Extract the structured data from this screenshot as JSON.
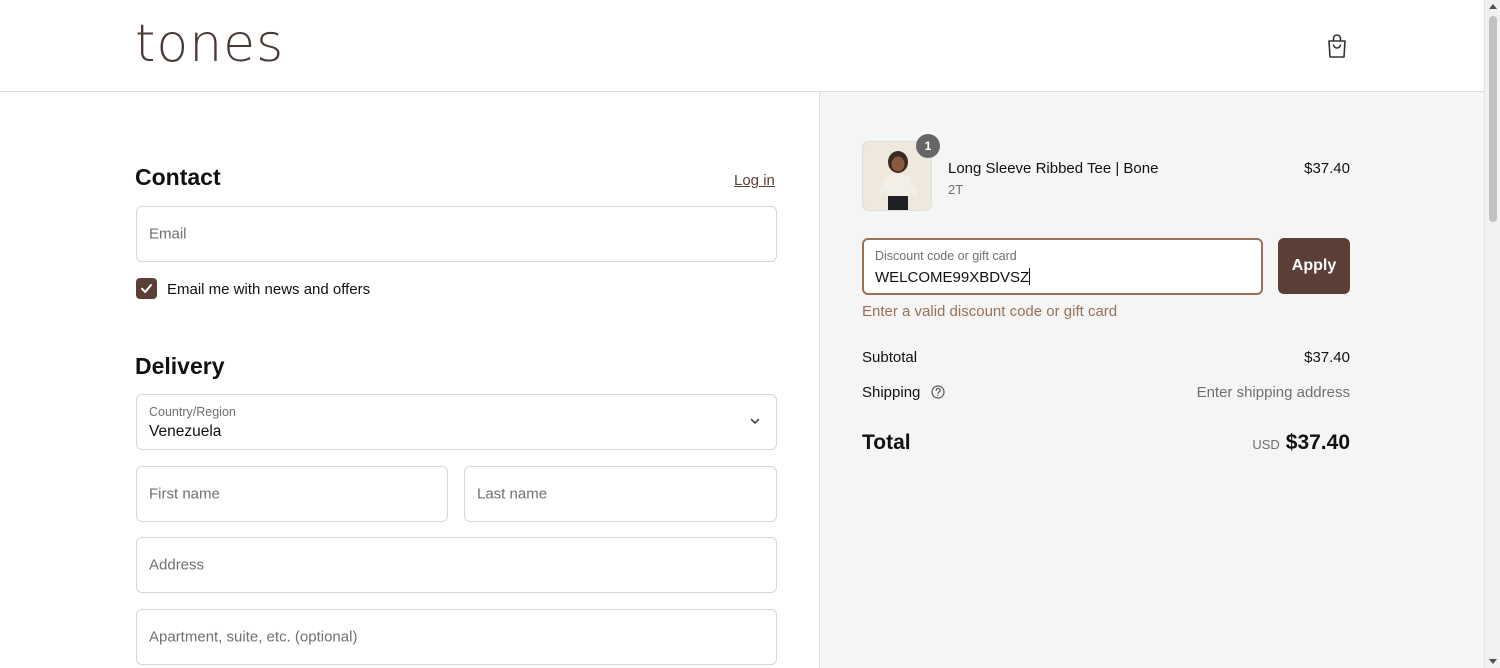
{
  "header": {
    "logo": "tones",
    "cart_icon": "shopping-bag-icon"
  },
  "contact": {
    "title": "Contact",
    "login_link": "Log in",
    "email_placeholder": "Email",
    "newsletter_label": "Email me with news and offers",
    "newsletter_checked": true
  },
  "delivery": {
    "title": "Delivery",
    "country_label": "Country/Region",
    "country_value": "Venezuela",
    "first_name_placeholder": "First name",
    "last_name_placeholder": "Last name",
    "address_placeholder": "Address",
    "apartment_placeholder": "Apartment, suite, etc. (optional)"
  },
  "order": {
    "item": {
      "quantity": "1",
      "name": "Long Sleeve Ribbed Tee | Bone",
      "variant": "2T",
      "price": "$37.40"
    },
    "discount": {
      "label": "Discount code or gift card",
      "value": "WELCOME99XBDVSZ",
      "apply_label": "Apply",
      "error": "Enter a valid discount code or gift card"
    },
    "subtotal_label": "Subtotal",
    "subtotal_value": "$37.40",
    "shipping_label": "Shipping",
    "shipping_value": "Enter shipping address",
    "total_label": "Total",
    "total_currency": "USD",
    "total_value": "$37.40"
  },
  "colors": {
    "brand": "#5b3f36",
    "accent_border": "#9a7256",
    "summary_bg": "#f5f5f5"
  }
}
